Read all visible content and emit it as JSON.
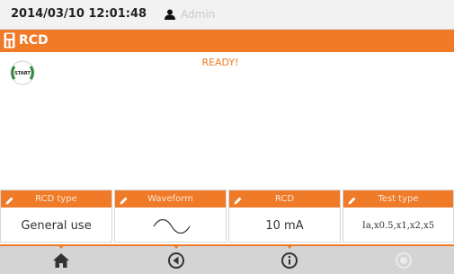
{
  "status_bar": {
    "datetime": "2014/03/10 12:01:48",
    "user": "Admin",
    "user_icon": "user-icon"
  },
  "title_bar": {
    "title": "RCD",
    "icon": "rcd-device-icon"
  },
  "main": {
    "start_label": "START",
    "status": "READY!"
  },
  "parameters": [
    {
      "label": "RCD type",
      "value": "General use"
    },
    {
      "label": "Waveform",
      "value": ""
    },
    {
      "label": "RCD",
      "value": "10 mA"
    },
    {
      "label": "Test type",
      "value": "Ia,x0.5,x1,x2,x5"
    }
  ],
  "nav": [
    {
      "icon": "home-icon"
    },
    {
      "icon": "back-icon"
    },
    {
      "icon": "info-icon"
    },
    {
      "icon": "record-icon",
      "disabled": true
    }
  ],
  "colors": {
    "accent": "#ef7a28",
    "start_ring": "#2e8b3a",
    "nav_bg": "#d4d4d4",
    "disabled": "#eaeaea"
  }
}
